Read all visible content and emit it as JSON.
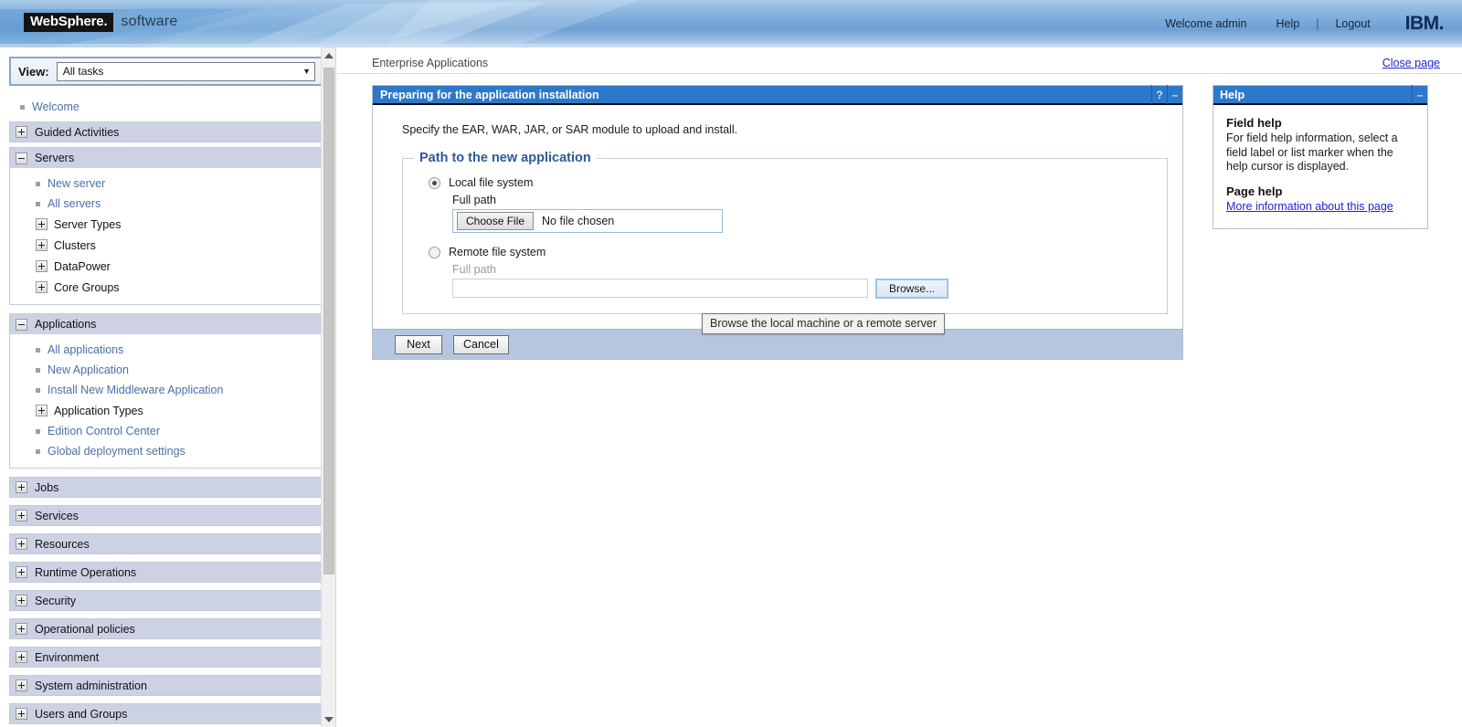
{
  "banner": {
    "product_mark": "WebSphere.",
    "product_suffix": "software",
    "welcome": "Welcome admin",
    "help": "Help",
    "separator": "|",
    "logout": "Logout",
    "ibm": "IBM."
  },
  "sidebar": {
    "view_label": "View:",
    "view_value": "All tasks",
    "caret": "▼",
    "welcome_link": "Welcome",
    "sections": [
      {
        "label": "Guided Activities",
        "state": "collapsed"
      },
      {
        "label": "Servers",
        "state": "expanded",
        "children": [
          {
            "label": "New server",
            "type": "link"
          },
          {
            "label": "All servers",
            "type": "link"
          },
          {
            "label": "Server Types",
            "type": "expandable"
          },
          {
            "label": "Clusters",
            "type": "expandable"
          },
          {
            "label": "DataPower",
            "type": "expandable"
          },
          {
            "label": "Core Groups",
            "type": "expandable"
          }
        ]
      },
      {
        "label": "Applications",
        "state": "expanded",
        "children": [
          {
            "label": "All applications",
            "type": "link"
          },
          {
            "label": "New Application",
            "type": "link"
          },
          {
            "label": "Install New Middleware Application",
            "type": "link"
          },
          {
            "label": "Application Types",
            "type": "expandable"
          },
          {
            "label": "Edition Control Center",
            "type": "link"
          },
          {
            "label": "Global deployment settings",
            "type": "link"
          }
        ]
      },
      {
        "label": "Jobs",
        "state": "collapsed"
      },
      {
        "label": "Services",
        "state": "collapsed"
      },
      {
        "label": "Resources",
        "state": "collapsed"
      },
      {
        "label": "Runtime Operations",
        "state": "collapsed"
      },
      {
        "label": "Security",
        "state": "collapsed"
      },
      {
        "label": "Operational policies",
        "state": "collapsed"
      },
      {
        "label": "Environment",
        "state": "collapsed"
      },
      {
        "label": "System administration",
        "state": "collapsed"
      },
      {
        "label": "Users and Groups",
        "state": "collapsed"
      }
    ]
  },
  "main": {
    "breadcrumb": "Enterprise Applications",
    "close_page": "Close page",
    "portlet": {
      "title": "Preparing for the application installation",
      "help_icon": "?",
      "minimize_icon": "–",
      "instruction": "Specify the EAR, WAR, JAR, or SAR module to upload and install.",
      "fieldset_legend": "Path to the new application",
      "local": {
        "radio_label": "Local file system",
        "selected": true,
        "field_label": "Full path",
        "choose_button": "Choose File",
        "filename": "No file chosen"
      },
      "remote": {
        "radio_label": "Remote file system",
        "selected": false,
        "field_label": "Full path",
        "input_value": "",
        "browse_button": "Browse..."
      },
      "tooltip": "Browse the local machine or a remote server",
      "buttons": {
        "next": "Next",
        "cancel": "Cancel"
      }
    },
    "help_portlet": {
      "title": "Help",
      "minimize_icon": "–",
      "field_help_heading": "Field help",
      "field_help_text": "For field help information, select a field label or list marker when the help cursor is displayed.",
      "page_help_heading": "Page help",
      "page_help_link": "More information about this page"
    }
  },
  "colors": {
    "portlet_title_bg": "#2e78ca",
    "button_bar_bg": "#b5c6e0",
    "nav_section_bg": "#ccd2e4",
    "link_blue": "#4b6ea9",
    "visited_link": "#1f23d6",
    "legend_blue": "#2d5a9a"
  }
}
